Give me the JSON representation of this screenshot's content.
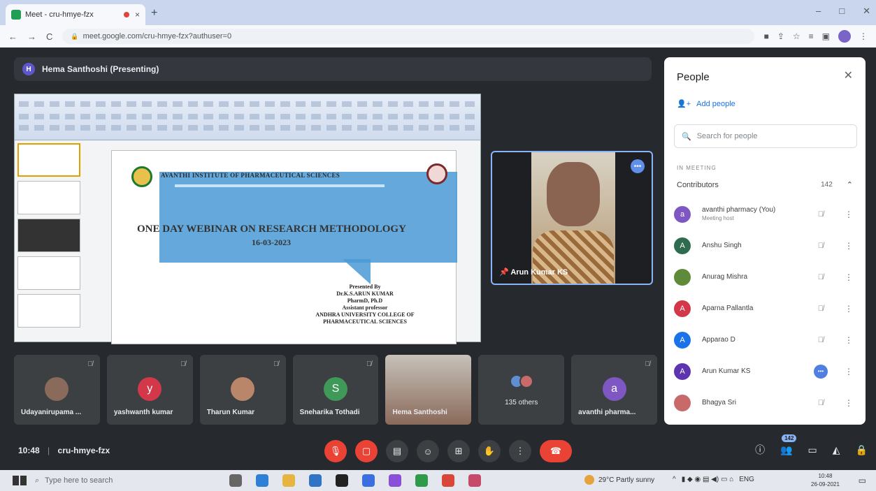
{
  "browser": {
    "tab_title": "Meet - cru-hmye-fzx",
    "tab_close": "×",
    "new_tab": "+",
    "window_controls": [
      "–",
      "□",
      "✕"
    ],
    "url": "meet.google.com/cru-hmye-fzx?authuser=0",
    "icons": [
      "back-icon",
      "forward-icon",
      "reload-icon",
      "lock-icon",
      "camera-icon",
      "share-icon",
      "star-icon",
      "extensions-icon",
      "sidepanel-icon",
      "profile-icon",
      "more-icon"
    ]
  },
  "presenter_bar": {
    "avatar_letter": "H",
    "text": "Hema Santhoshi (Presenting)"
  },
  "slide": {
    "institute": "AVANTHI INSTITUTE OF PHARMACEUTICAL SCIENCES",
    "title": "ONE DAY WEBINAR ON RESEARCH METHODOLOGY",
    "date": "16-03-2023",
    "presented_by": "Presented By",
    "presenter_name": "Dr.K.S.ARUN KUMAR",
    "qualification": "PharmD, Ph.D",
    "designation": "Assistant professor",
    "college_line1": "ANDHRA UNIVERSITY COLLEGE OF",
    "college_line2": "PHARMACEUTICAL SCIENCES"
  },
  "camera_tile": {
    "name": "Arun Kumar KS",
    "dots": "•••"
  },
  "tiles": [
    {
      "name": "Udayanirupama ...",
      "avatar_color": "#8a6a5a",
      "letter": ""
    },
    {
      "name": "yashwanth kumar",
      "avatar_color": "#d2374a",
      "letter": "y"
    },
    {
      "name": "Tharun Kumar",
      "avatar_color": "#b9866a",
      "letter": ""
    },
    {
      "name": "Sneharika Tothadi",
      "avatar_color": "#3f9a5a",
      "letter": "S"
    },
    {
      "name": "Hema Santhoshi",
      "avatar_color": "",
      "letter": ""
    },
    {
      "name": "135 others",
      "avatar_color": "",
      "letter": ""
    },
    {
      "name": "avanthi pharma...",
      "avatar_color": "#7e57c2",
      "letter": "a"
    }
  ],
  "bottom": {
    "time": "10:48",
    "meeting_code": "cru-hmye-fzx",
    "people_count": "142"
  },
  "people_panel": {
    "title": "People",
    "add_people": "Add people",
    "search_placeholder": "Search for people",
    "section": "IN MEETING",
    "contributors_label": "Contributors",
    "contributors_count": "142",
    "people": [
      {
        "name": "avanthi pharmacy (You)",
        "role": "Meeting host",
        "letter": "a",
        "color": "#7e57c2"
      },
      {
        "name": "Anshu Singh",
        "role": "",
        "letter": "A",
        "color": "#2e6b4f"
      },
      {
        "name": "Anurag Mishra",
        "role": "",
        "letter": "",
        "color": "#5f8a3a"
      },
      {
        "name": "Aparna Pallantla",
        "role": "",
        "letter": "A",
        "color": "#d2374a"
      },
      {
        "name": "Apparao D",
        "role": "",
        "letter": "A",
        "color": "#1a73e8"
      },
      {
        "name": "Arun Kumar KS",
        "role": "",
        "letter": "A",
        "color": "#5e35b1"
      },
      {
        "name": "Bhagya Sri",
        "role": "",
        "letter": "",
        "color": "#c96a6a"
      }
    ]
  },
  "taskbar": {
    "search_placeholder": "Type here to search",
    "weather": "29°C Partly sunny",
    "lang": "ENG",
    "clock_time": "10:48",
    "clock_date": "26-09-2021"
  }
}
